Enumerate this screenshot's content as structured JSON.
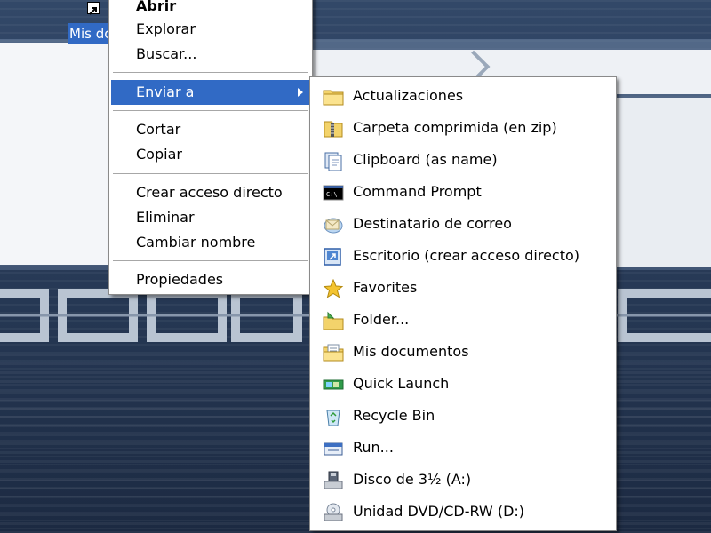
{
  "desktop": {
    "icon": {
      "caption": "Mis documentos",
      "icon_name": "folder-shortcut-icon",
      "selected": true,
      "selection_color": "#316ac5"
    }
  },
  "context_menu": {
    "items": [
      {
        "label": "Abrir",
        "bold": true
      },
      {
        "label": "Explorar"
      },
      {
        "label": "Buscar..."
      },
      {
        "label": "Enviar a",
        "highlighted": true,
        "has_submenu": true
      },
      {
        "label": "Cortar"
      },
      {
        "label": "Copiar"
      },
      {
        "label": "Crear acceso directo"
      },
      {
        "label": "Eliminar"
      },
      {
        "label": "Cambiar nombre"
      },
      {
        "label": "Propiedades"
      }
    ]
  },
  "sendto_menu": {
    "items": [
      {
        "label": "Actualizaciones",
        "icon": "folder-icon"
      },
      {
        "label": "Carpeta comprimida (en zip)",
        "icon": "zip-folder-icon"
      },
      {
        "label": "Clipboard (as name)",
        "icon": "clipboard-icon"
      },
      {
        "label": "Command Prompt",
        "icon": "command-prompt-icon"
      },
      {
        "label": "Destinatario de correo",
        "icon": "mail-recipient-icon"
      },
      {
        "label": "Escritorio (crear acceso directo)",
        "icon": "desktop-shortcut-icon"
      },
      {
        "label": "Favorites",
        "icon": "favorites-star-icon"
      },
      {
        "label": "Folder...",
        "icon": "folder-arrow-icon"
      },
      {
        "label": "Mis documentos",
        "icon": "my-documents-icon"
      },
      {
        "label": "Quick Launch",
        "icon": "quick-launch-icon"
      },
      {
        "label": "Recycle Bin",
        "icon": "recycle-bin-icon"
      },
      {
        "label": "Run...",
        "icon": "run-icon"
      },
      {
        "label": "Disco de 3½ (A:)",
        "icon": "floppy-drive-icon"
      },
      {
        "label": "Unidad DVD/CD-RW (D:)",
        "icon": "dvd-drive-icon"
      }
    ]
  },
  "colors": {
    "highlight": "#316ac5",
    "menu_background": "#ffffff",
    "desktop_background": "#2a3d5b"
  }
}
